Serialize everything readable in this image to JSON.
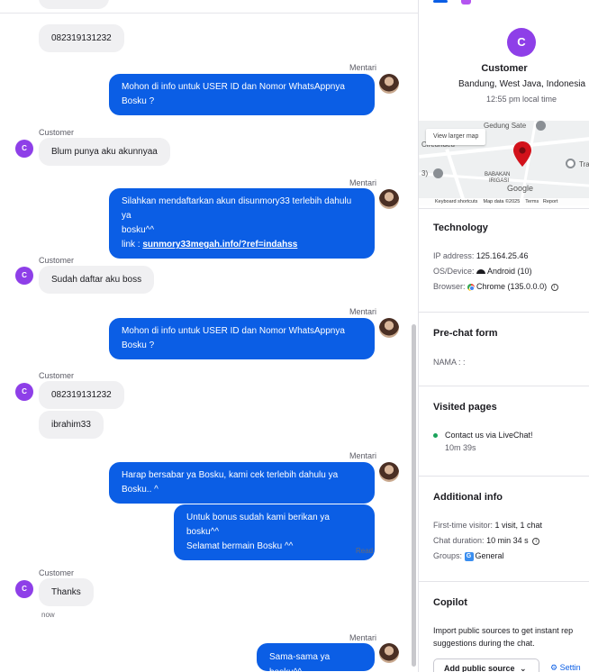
{
  "chat": {
    "customer_initial": "C",
    "messages": {
      "m0": {
        "text": "082319131232"
      },
      "m1": {
        "sender": "Mentari",
        "lines": [
          "Mohon di info untuk USER ID dan Nomor WhatsAppnya",
          "Bosku ?"
        ]
      },
      "m2": {
        "sender": "Customer",
        "text": "Blum punya aku akunnyaa"
      },
      "m3": {
        "sender": "Mentari",
        "lines": [
          "Silahkan mendaftarkan akun disunmory33 terlebih dahulu ya",
          "bosku^^"
        ],
        "link_prefix": "link : ",
        "link": "sunmory33megah.info/?ref=indahss"
      },
      "m4": {
        "sender": "Customer",
        "text": "Sudah daftar aku boss"
      },
      "m5": {
        "sender": "Mentari",
        "lines": [
          "Mohon di info untuk USER ID dan Nomor WhatsAppnya",
          "Bosku ?"
        ]
      },
      "m6": {
        "sender": "Customer",
        "text_a": "082319131232",
        "text_b": "ibrahim33"
      },
      "m7": {
        "sender": "Mentari",
        "lines": [
          "Harap bersabar ya Bosku, kami cek terlebih dahulu ya",
          "Bosku.. ^"
        ]
      },
      "m8": {
        "lines": [
          "Untuk bonus sudah kami berikan ya bosku^^",
          "Selamat bermain Bosku ^^"
        ],
        "status": "Read"
      },
      "m9": {
        "sender": "Customer",
        "text": "Thanks",
        "time": "now"
      },
      "m10": {
        "sender": "Mentari",
        "text": "Sama-sama ya bosku^^"
      }
    }
  },
  "panel": {
    "customer": {
      "initial": "C",
      "name": "Customer",
      "location": "Bandung, West Java, Indonesia",
      "local_time": "12:55 pm local time"
    },
    "map": {
      "view_larger": "View larger map",
      "label_gedung": "Gedung Sate",
      "label_cireundeu": "Cireundeu",
      "label_babakan_1": "BABAKAN",
      "label_babakan_2": "IRIGASI",
      "label_tra": "Tra",
      "label_3": "3)",
      "google": "Google",
      "footer_shortcuts": "Keyboard shortcuts",
      "footer_data": "Map data ©2025",
      "footer_terms": "Terms",
      "footer_report": "Report"
    },
    "technology": {
      "title": "Technology",
      "ip_label": "IP address:",
      "ip_value": "125.164.25.46",
      "os_label": "OS/Device:",
      "os_value": "Android (10)",
      "browser_label": "Browser:",
      "browser_value": "Chrome (135.0.0.0)"
    },
    "prechat": {
      "title": "Pre-chat form",
      "nama": "NAMA : :"
    },
    "visited": {
      "title": "Visited pages",
      "page": "Contact us via LiveChat!",
      "duration": "10m 39s"
    },
    "additional": {
      "title": "Additional info",
      "first_label": "First-time visitor:",
      "first_value": "1 visit, 1 chat",
      "duration_label": "Chat duration:",
      "duration_value": "10 min 34 s",
      "groups_label": "Groups:",
      "groups_value": "General",
      "groups_badge": "G"
    },
    "copilot": {
      "title": "Copilot",
      "desc_1": "Import public sources to get instant rep",
      "desc_2": "suggestions during the chat.",
      "add_button": "Add public source",
      "settings": "Settin"
    }
  }
}
